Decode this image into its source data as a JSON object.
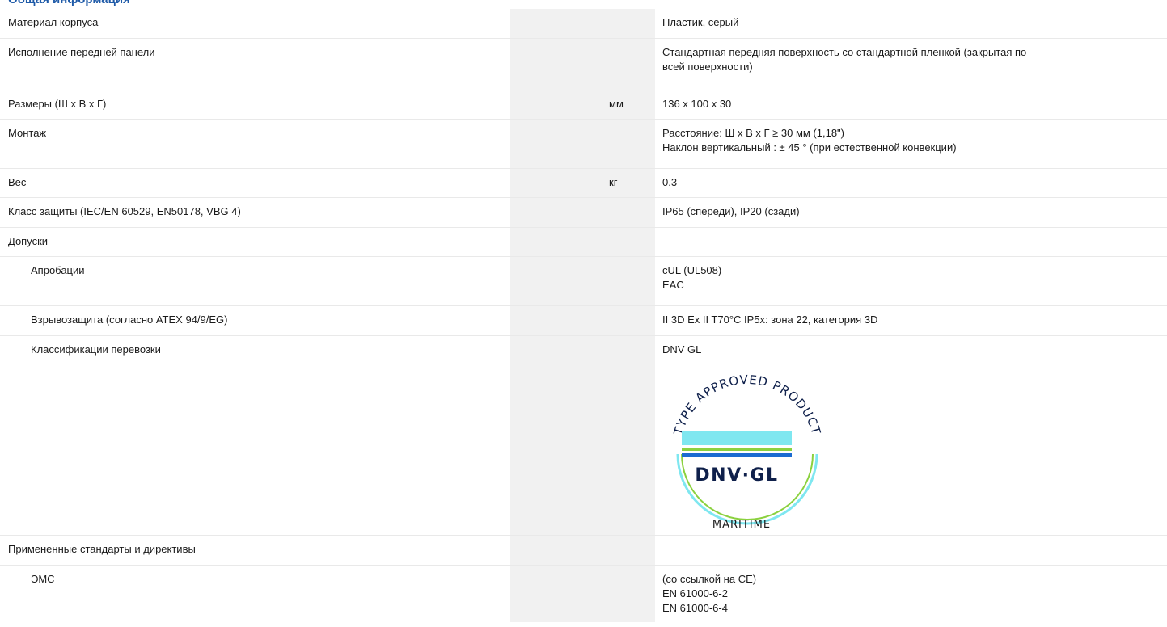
{
  "section_title": "Общая информация",
  "rows": [
    {
      "label": "Материал корпуса",
      "unit": "",
      "values": [
        "Пластик, серый"
      ]
    },
    {
      "label": "Исполнение передней панели",
      "unit": "",
      "values": [
        "Стандартная передняя поверхность со стандартной пленкой (закрытая по",
        "всей поверхности)"
      ]
    },
    {
      "label": "Размеры (Ш x В x Г)",
      "unit": "мм",
      "values": [
        "136 x 100 x 30"
      ]
    },
    {
      "label": "Монтаж",
      "unit": "",
      "values": [
        "Расстояние: Ш x В x Г ≥ 30 мм (1,18\")",
        "Наклон вертикальный : ± 45 ° (при естественной конвекции)"
      ]
    },
    {
      "label": "Вес",
      "unit": "кг",
      "values": [
        "0.3"
      ]
    },
    {
      "label": "Класс защиты (IEC/EN 60529, EN50178, VBG 4)",
      "unit": "",
      "values": [
        "IP65 (спереди), IP20 (сзади)"
      ]
    },
    {
      "label": "Допуски",
      "unit": "",
      "values": [
        ""
      ]
    },
    {
      "label": "Апробации",
      "unit": "",
      "values": [
        "cUL (UL508)",
        "EAC"
      ]
    },
    {
      "label": "Взрывозащита (согласно ATEX 94/9/EG)",
      "unit": "",
      "values": [
        "II 3D Ex II T70°C IP5x: зона 22, категория 3D"
      ]
    },
    {
      "label": "Классификации перевозки",
      "unit": "",
      "values": [
        "DNV GL"
      ]
    },
    {
      "label": "Примененные стандарты и директивы",
      "unit": "",
      "values": [
        ""
      ]
    },
    {
      "label": "ЭМС",
      "unit": "",
      "values": [
        "(со ссылкой на CE)",
        "EN 61000-6-2",
        "EN 61000-6-4"
      ]
    }
  ],
  "badge": {
    "arc_text": "TYPE APPROVED PRODUCT",
    "brand": "DNV·GL",
    "bottom_text": "MARITIME",
    "colors": {
      "cyan": "#7fe7f0",
      "green": "#8bd13f",
      "blue": "#1b6bd1",
      "navy": "#0f204b"
    }
  }
}
